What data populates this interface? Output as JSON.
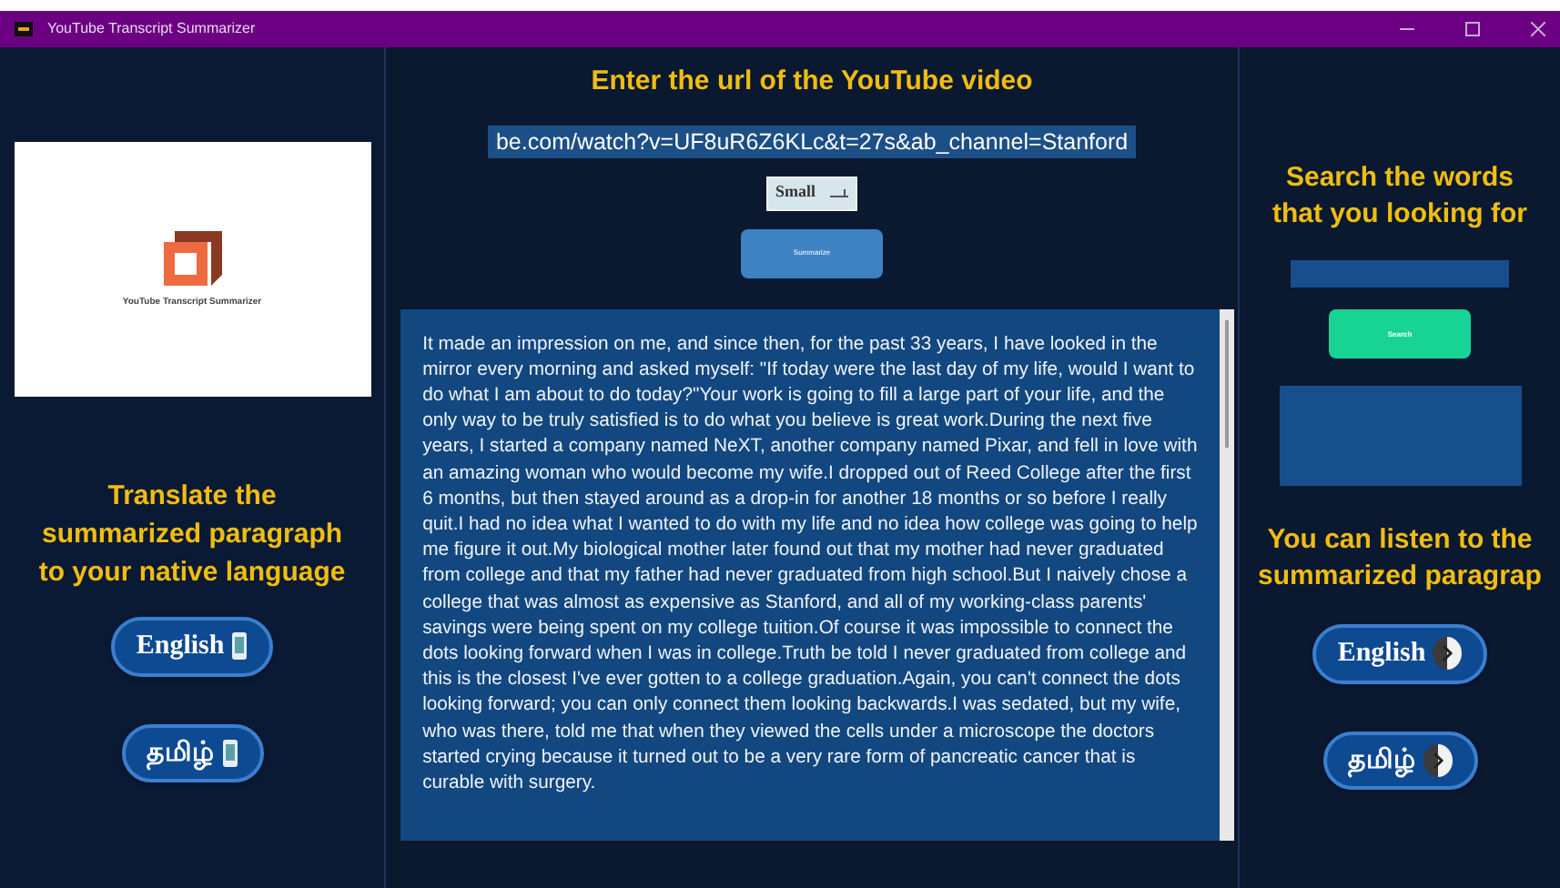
{
  "window": {
    "title": "YouTube Transcript Summarizer"
  },
  "left": {
    "logo_caption": "YouTube Transcript Summarizer",
    "heading": "Translate the summarized paragraph to your native language",
    "buttons": [
      {
        "label": "English"
      },
      {
        "label": "தமிழ்"
      }
    ]
  },
  "center": {
    "heading": "Enter the url of the YouTube video",
    "url": "be.com/watch?v=UF8uR6Z6KLc&t=27s&ab_channel=Stanford",
    "size": "Small",
    "summarize": "Summarize",
    "summary": "It made an impression on me, and since then, for the past 33 years, I have looked in the mirror every morning and asked myself: \"If today were the last day of my life, would I want to do what I am about to do today?\"Your work is going to fill a large part of your life, and the only way to be truly satisfied is to do what you believe is great work.During the next five years, I started a company named NeXT, another company named Pixar, and fell in love with an amazing woman who would become my wife.I dropped out of Reed College after the first 6 months, but then stayed around as a drop-in for another 18 months or so before I really quit.I had no idea what I wanted to do with my life and no idea how college was going to help me figure it out.My biological mother later found out that my mother had never graduated from college and that my father had never graduated from high school.But I naively chose a college that was almost as expensive as Stanford, and all of my working-class parents' savings were being spent on my college tuition.Of course it was impossible to connect the dots looking forward when I was in college.Truth be told I never graduated from college and this is the closest I've ever gotten to a college graduation.Again, you can't connect the dots looking forward; you can only connect them looking backwards.I was sedated, but my wife, who was there, told me that when they viewed the cells under a microscope the doctors started crying because it turned out to be a very rare form of pancreatic cancer that is curable with surgery."
  },
  "right": {
    "heading": "Search the words that you looking for",
    "search": "Search",
    "listen_heading": "You can listen to the summarized paragrap",
    "buttons": [
      {
        "label": "English"
      },
      {
        "label": "தமிழ்"
      }
    ]
  }
}
